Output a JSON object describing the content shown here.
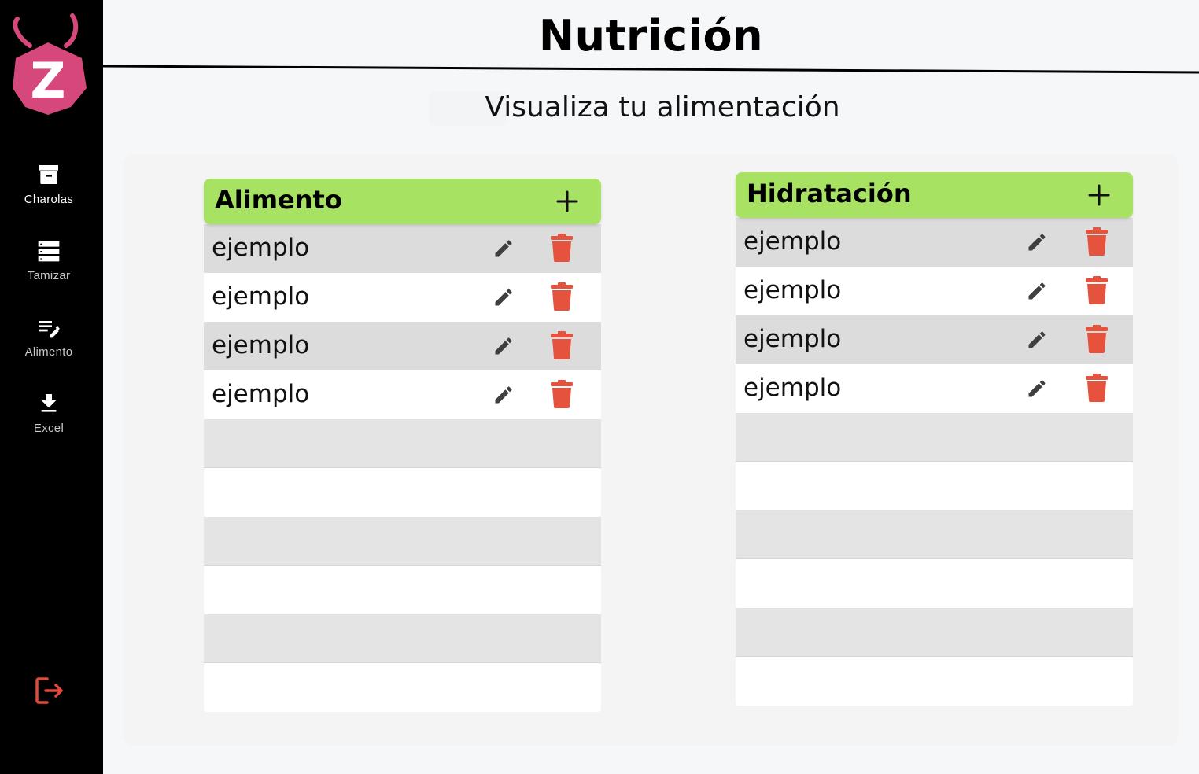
{
  "brand": {
    "logo_letter": "Z",
    "logo_color": "#d6477b"
  },
  "sidebar": {
    "items": [
      {
        "label": "Charolas",
        "icon": "archive-icon",
        "active": true
      },
      {
        "label": "Tamizar",
        "icon": "list-icon",
        "active": false
      },
      {
        "label": "Alimento",
        "icon": "edit-list-icon",
        "active": false
      },
      {
        "label": "Excel",
        "icon": "download-icon",
        "active": false
      }
    ],
    "logout_icon": "logout-icon",
    "logout_color": "#e04a3a"
  },
  "header": {
    "title": "Nutrición",
    "subtitle": "Visualiza tu alimentación"
  },
  "colors": {
    "accent_green": "#a8e263",
    "delete_red": "#e5533f",
    "edit_gray": "#3f3f3f",
    "row_gray": "#dcdcdc"
  },
  "tables": {
    "food": {
      "title": "Alimento",
      "add_icon": "plus-icon",
      "items": [
        "ejemplo",
        "ejemplo",
        "ejemplo",
        "ejemplo"
      ],
      "empty_rows": 6
    },
    "hydration": {
      "title": "Hidratación",
      "add_icon": "plus-icon",
      "items": [
        "ejemplo",
        "ejemplo",
        "ejemplo",
        "ejemplo"
      ],
      "empty_rows": 6
    }
  }
}
